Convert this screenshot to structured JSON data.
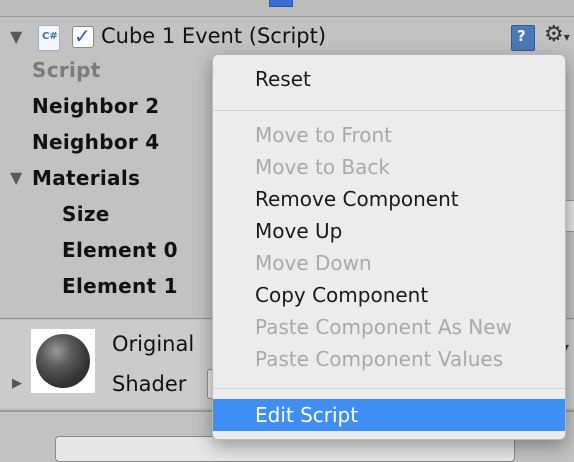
{
  "component": {
    "title": "Cube 1 Event (Script)",
    "script_icon_text": "C#",
    "enabled": true,
    "help_icon_text": "?",
    "settings_icon": "gear-icon"
  },
  "inspector": {
    "script_label": "Script",
    "neighbor2_label": "Neighbor 2",
    "neighbor4_label": "Neighbor 4",
    "materials_label": "Materials",
    "size_label": "Size",
    "element0_label": "Element 0",
    "element1_label": "Element 1"
  },
  "material": {
    "name": "Original",
    "shader_label": "Shader"
  },
  "context_menu": {
    "items": [
      {
        "label": "Reset",
        "enabled": true
      },
      {
        "label": "Move to Front",
        "enabled": false
      },
      {
        "label": "Move to Back",
        "enabled": false
      },
      {
        "label": "Remove Component",
        "enabled": true
      },
      {
        "label": "Move Up",
        "enabled": true
      },
      {
        "label": "Move Down",
        "enabled": false
      },
      {
        "label": "Copy Component",
        "enabled": true
      },
      {
        "label": "Paste Component As New",
        "enabled": false
      },
      {
        "label": "Paste Component Values",
        "enabled": false
      },
      {
        "label": "Edit Script",
        "enabled": true,
        "highlighted": true
      }
    ]
  },
  "colors": {
    "highlight": "#3e8ef3",
    "panel_bg": "#c2c2c2",
    "menu_bg": "#ececec"
  }
}
